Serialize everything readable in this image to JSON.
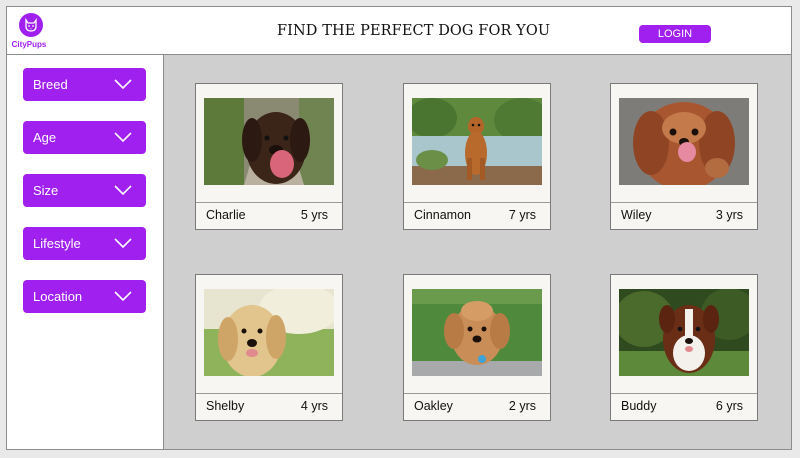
{
  "app": {
    "brand": "CityPups",
    "title": "FIND THE PERFECT DOG FOR YOU",
    "login_label": "LOGIN",
    "accent_color": "#a020f0"
  },
  "filters": [
    {
      "label": "Breed",
      "icon": "chevron-down-icon"
    },
    {
      "label": "Age",
      "icon": "chevron-down-icon"
    },
    {
      "label": "Size",
      "icon": "chevron-down-icon"
    },
    {
      "label": "Lifestyle",
      "icon": "chevron-down-icon"
    },
    {
      "label": "Location",
      "icon": "chevron-down-icon"
    }
  ],
  "dogs": [
    {
      "name": "Charlie",
      "age": "5 yrs"
    },
    {
      "name": "Cinnamon",
      "age": "7 yrs"
    },
    {
      "name": "Wiley",
      "age": "3 yrs"
    },
    {
      "name": "Shelby",
      "age": "4 yrs"
    },
    {
      "name": "Oakley",
      "age": "2 yrs"
    },
    {
      "name": "Buddy",
      "age": "6 yrs"
    }
  ]
}
